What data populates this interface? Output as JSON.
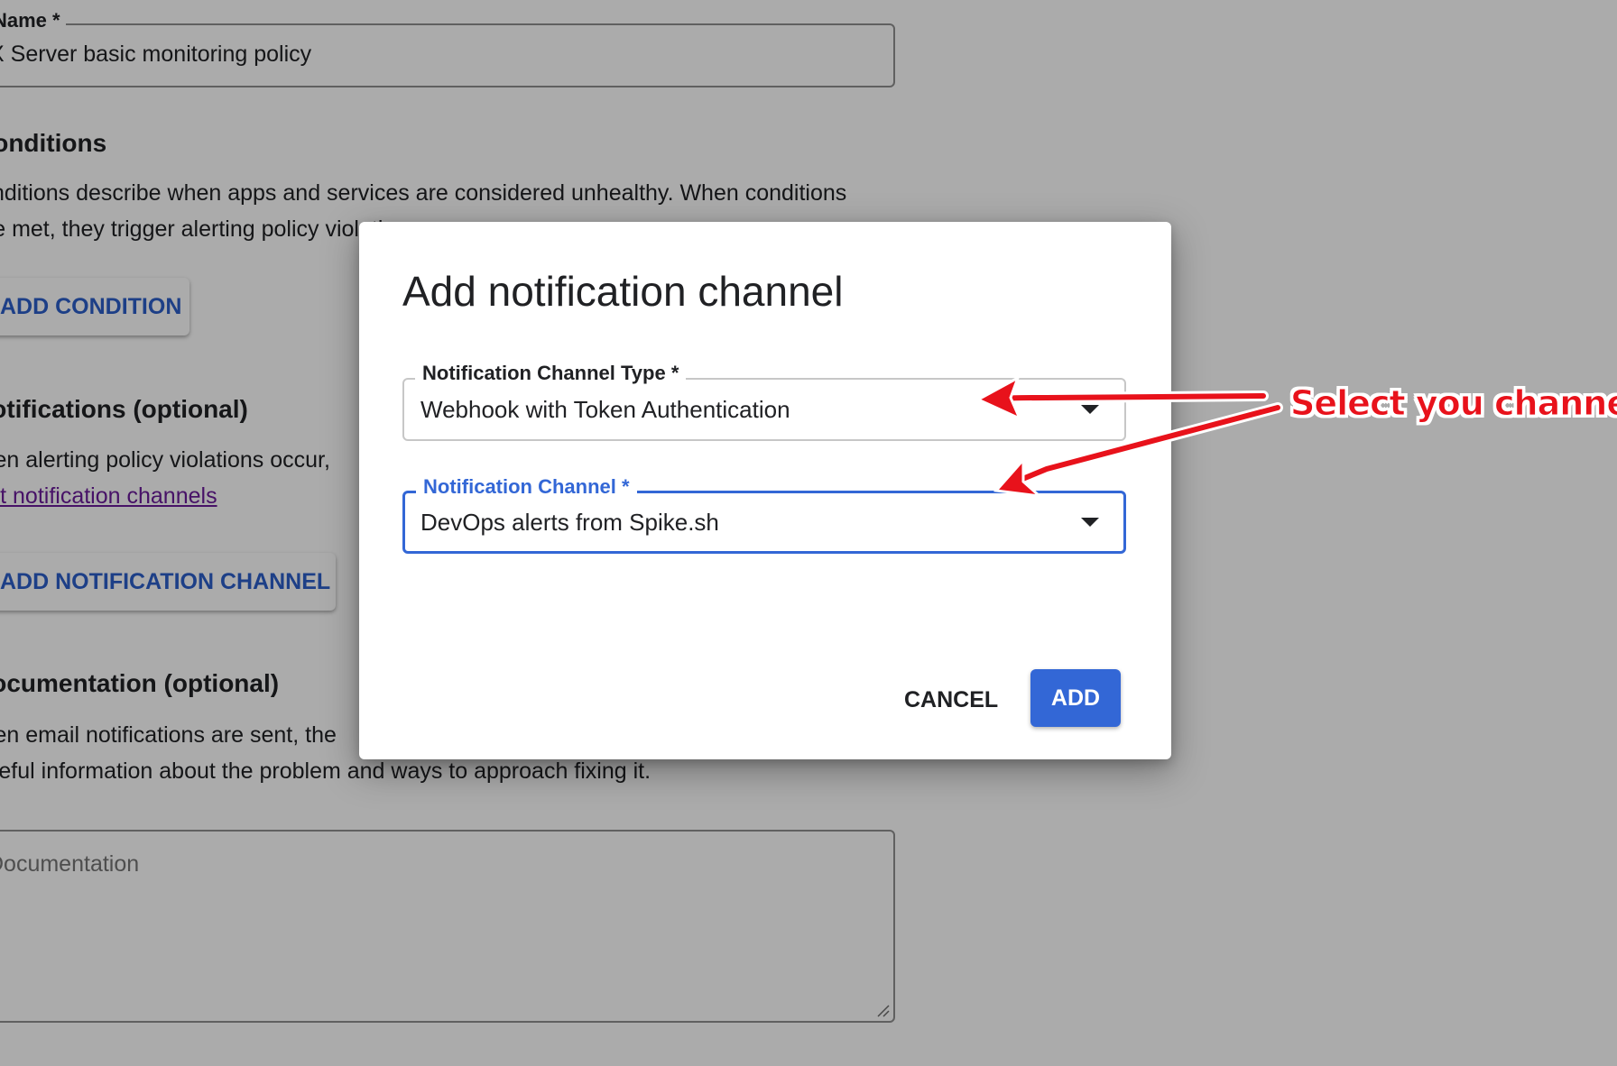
{
  "background_form": {
    "name_field": {
      "label": "Name *",
      "value": "RX Server basic monitoring policy"
    },
    "conditions": {
      "heading": "Conditions",
      "description_line1": "Conditions describe when apps and services are considered unhealthy. When conditions",
      "description_line2": "are met, they trigger alerting policy violations.",
      "add_button": "ADD CONDITION"
    },
    "notifications": {
      "heading": "Notifications (optional)",
      "description_line1": "When alerting policy violations occur,",
      "edit_link": "Edit notification channels",
      "add_button": "ADD NOTIFICATION CHANNEL"
    },
    "documentation": {
      "heading": "Documentation (optional)",
      "description_line1": "When email notifications are sent, the",
      "description_line2": "useful information about the problem and ways to approach fixing it.",
      "placeholder": "Documentation"
    }
  },
  "dialog": {
    "title": "Add notification channel",
    "channel_type": {
      "label": "Notification Channel Type *",
      "value": "Webhook with Token Authentication"
    },
    "channel": {
      "label": "Notification Channel *",
      "value": "DevOps alerts from Spike.sh"
    },
    "cancel_label": "CANCEL",
    "add_label": "ADD"
  },
  "annotation": {
    "text": "Select you channel",
    "color": "#e8121b"
  },
  "colors": {
    "primary": "#3367d6",
    "link": "#6a1b9a",
    "scrim": "rgba(0,0,0,0.33)"
  }
}
